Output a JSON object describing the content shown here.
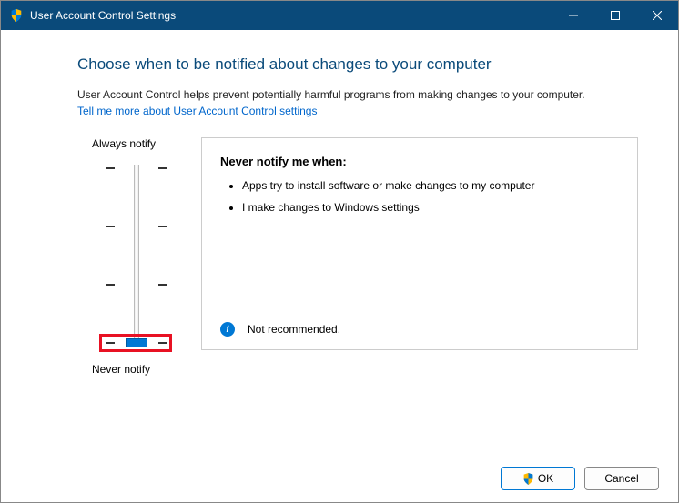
{
  "window": {
    "title": "User Account Control Settings"
  },
  "heading": "Choose when to be notified about changes to your computer",
  "description": "User Account Control helps prevent potentially harmful programs from making changes to your computer.",
  "link_text": "Tell me more about User Account Control settings",
  "slider": {
    "top_label": "Always notify",
    "bottom_label": "Never notify",
    "levels": 4,
    "current_level": 0
  },
  "detail": {
    "title": "Never notify me when:",
    "bullets": [
      "Apps try to install software or make changes to my computer",
      "I make changes to Windows settings"
    ],
    "recommendation": "Not recommended."
  },
  "buttons": {
    "ok": "OK",
    "cancel": "Cancel"
  }
}
